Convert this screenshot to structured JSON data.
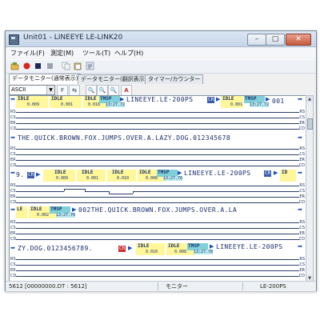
{
  "window": {
    "title": "Unit01 - LINEEYE LE-LINK20",
    "min": "–",
    "max": "□",
    "close": "✕"
  },
  "menu": [
    {
      "label": "ファイル(F)"
    },
    {
      "label": "測定(M)"
    },
    {
      "label": "ツール(T)"
    },
    {
      "label": "ヘルプ(H)"
    }
  ],
  "toolbar": {
    "icons": [
      "folder-open-icon",
      "record-icon",
      "stop-icon",
      "stop-square-icon",
      "copy-icon",
      "paste-icon",
      "settings-icon"
    ]
  },
  "tabs": [
    {
      "label": "データモニター(通常表示)",
      "active": true
    },
    {
      "label": "データモニター(翻訳表示)",
      "active": false
    },
    {
      "label": "タイマー/カウンター",
      "active": false
    }
  ],
  "options": {
    "code": "ASCII",
    "buttons": [
      "F",
      "⇆",
      "🔍",
      "🔍",
      "🔍",
      "A"
    ]
  },
  "monitor": {
    "row_labels": [
      "RS",
      "CS",
      "ER",
      "CD"
    ],
    "idle_label": "IDLE",
    "tmsp_label": "TMSP",
    "blocks": [
      {
        "text": "LINEEYE.LE-200PS",
        "idle": [
          "0.009",
          "0.001",
          "0.018"
        ],
        "tmsp": "13:27.72",
        "ctrl": "CR",
        "tail_idle": "0.001",
        "tail_tmsp": "13:27.72",
        "tail_text": "001"
      },
      {
        "text": "THE.QUICK.BROWN.FOX.JUMPS.OVER.A.LAZY.DOG.012345678"
      },
      {
        "lead": "9.",
        "lead_ctrl": "CR",
        "idle": [
          "0.009",
          "0.001",
          "0.010",
          "0.008"
        ],
        "tmsp": "13:27.76",
        "text": "LINEEYE.LE-200PS",
        "ctrl": "CR",
        "tail_idle": "ID"
      },
      {
        "lead": "LE",
        "idle": [
          "0.002"
        ],
        "tmsp": "13:27.76",
        "text": "002THE.QUICK.BROWN.FOX.JUMPS.OVER.A.LA"
      },
      {
        "lead": "ZY.DOG.0123456789.",
        "lead_ctrl": "CR",
        "idle": [
          "0.010",
          "0.008"
        ],
        "tmsp": "13:27.78",
        "text": "LINEEYE.LE-200PS"
      }
    ]
  },
  "status": {
    "count": "5612 [00000000.DT : 5612]",
    "mode": "モニター",
    "device": "LE-200PS"
  },
  "colors": {
    "idle_bg": "#fff79a",
    "tmsp_bg": "#7fd0d8",
    "ctrl_bg": "#3b5bb0",
    "text": "#1b2e6b"
  }
}
